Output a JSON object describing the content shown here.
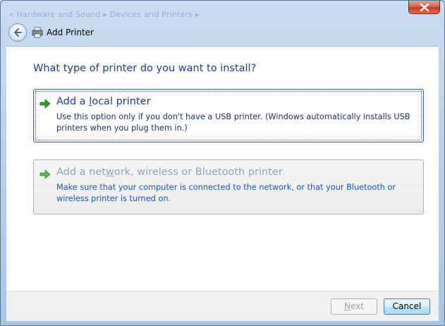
{
  "titlebar": {
    "breadcrumb": "« Hardware and Sound ▸ Devices and Printers ▸",
    "close_label": "Close"
  },
  "header": {
    "title": "Add Printer",
    "back_label": "Back"
  },
  "main": {
    "question": "What type of printer do you want to install?",
    "options": [
      {
        "title_pre": "Add a ",
        "title_accel": "l",
        "title_post": "ocal printer",
        "description": "Use this option only if you don't have a USB printer. (Windows automatically installs USB printers when you plug them in.)",
        "state": "focused"
      },
      {
        "title_pre": "Add a net",
        "title_accel": "w",
        "title_post": "ork, wireless or Bluetooth printer",
        "description": "Make sure that your computer is connected to the network, or that your Bluetooth or wireless printer is turned on.",
        "state": "normal"
      }
    ]
  },
  "footer": {
    "next_accel": "N",
    "next_rest": "ext",
    "next_enabled": false,
    "cancel_label": "Cancel"
  },
  "icons": {
    "arrow": "green-right-arrow-icon",
    "printer": "printer-icon",
    "back": "back-arrow-icon",
    "close": "close-x-icon"
  },
  "colors": {
    "heading_blue": "#1e3b8c",
    "link_blue": "#0f56c8",
    "disabled_title": "#8fa3c2",
    "close_red": "#c23e2a",
    "arrow_green": "#2f9e2f"
  }
}
